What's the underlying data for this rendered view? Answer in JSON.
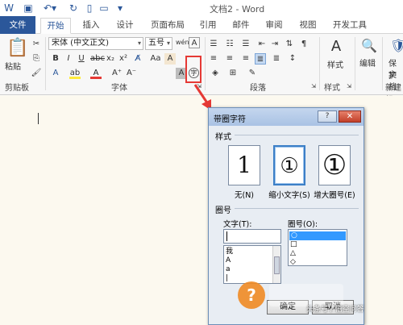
{
  "title_bar": {
    "title": "文档2 - Word"
  },
  "tabs": [
    {
      "label": "文件"
    },
    {
      "label": "开始"
    },
    {
      "label": "插入"
    },
    {
      "label": "设计"
    },
    {
      "label": "页面布局"
    },
    {
      "label": "引用"
    },
    {
      "label": "邮件"
    },
    {
      "label": "审阅"
    },
    {
      "label": "视图"
    },
    {
      "label": "开发工具"
    }
  ],
  "ribbon": {
    "clipboard": {
      "paste_label": "粘贴",
      "group_label": "剪贴板"
    },
    "font": {
      "font_name": "宋体 (中文正文)",
      "font_size": "五号",
      "group_label": "字体",
      "enclosed_char_glyph": "字"
    },
    "paragraph": {
      "group_label": "段落"
    },
    "styles": {
      "styles_label": "样式",
      "group_label": "样式"
    },
    "editing": {
      "editing_label": "编辑"
    },
    "protect": {
      "line1": "保护",
      "line2": "文档",
      "group_label": "新建组"
    }
  },
  "dialog": {
    "title": "带圈字符",
    "help_label": "?",
    "close_label": "✕",
    "style_section": "样式",
    "style_options": [
      {
        "glyph": "1",
        "label": "无(N)"
      },
      {
        "glyph": "①",
        "label": "缩小文字(S)"
      },
      {
        "glyph": "①",
        "label": "增大圈号(E)"
      }
    ],
    "circle_section": "圈号",
    "text_label": "文字(T):",
    "circle_label": "圈号(O):",
    "text_value": "",
    "text_list": [
      "我",
      "A",
      "a",
      "|"
    ],
    "circle_list": [
      "○",
      "□",
      "△",
      "◇"
    ],
    "ok_label": "确定",
    "cancel_label": "取消"
  },
  "watermark": {
    "text": "头条号 / 悟空问答"
  },
  "colors": {
    "accent": "#2b579a",
    "highlight": "#e53935"
  }
}
